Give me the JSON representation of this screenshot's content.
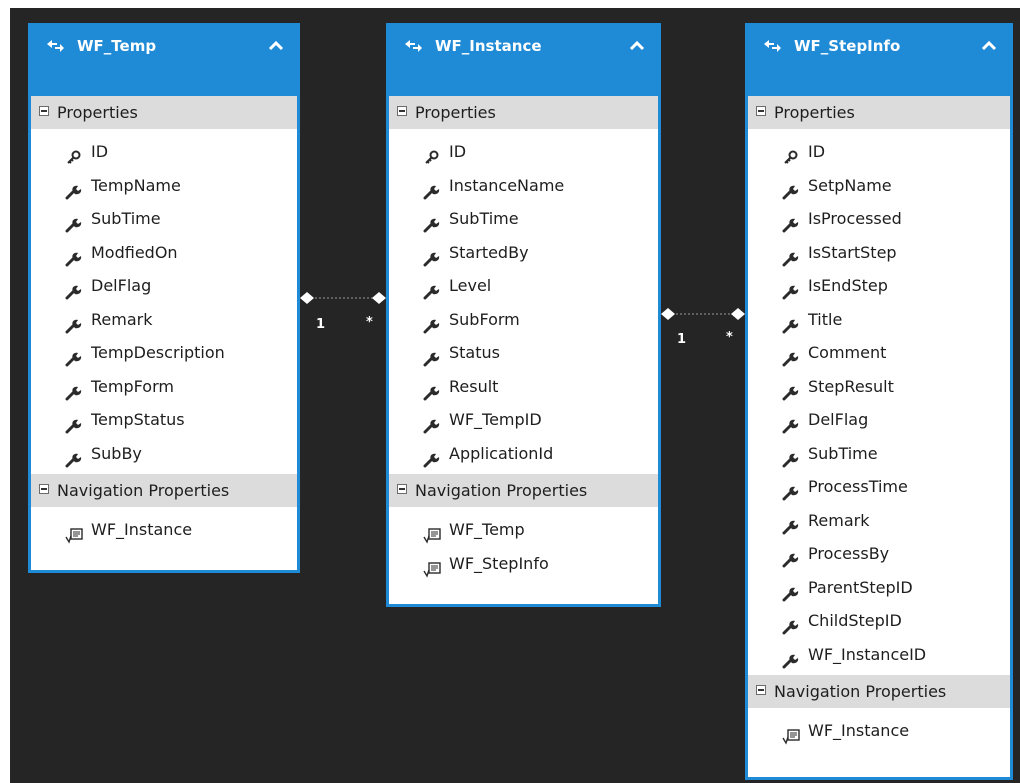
{
  "entities": {
    "temp": {
      "title": "WF_Temp",
      "properties_label": "Properties",
      "navigation_label": "Navigation Properties",
      "properties": [
        {
          "label": "ID",
          "icon": "key-icon"
        },
        {
          "label": "TempName",
          "icon": "wrench-icon"
        },
        {
          "label": "SubTime",
          "icon": "wrench-icon"
        },
        {
          "label": "ModfiedOn",
          "icon": "wrench-icon"
        },
        {
          "label": "DelFlag",
          "icon": "wrench-icon"
        },
        {
          "label": "Remark",
          "icon": "wrench-icon"
        },
        {
          "label": "TempDescription",
          "icon": "wrench-icon"
        },
        {
          "label": "TempForm",
          "icon": "wrench-icon"
        },
        {
          "label": "TempStatus",
          "icon": "wrench-icon"
        },
        {
          "label": "SubBy",
          "icon": "wrench-icon"
        }
      ],
      "navigation": [
        {
          "label": "WF_Instance",
          "icon": "navigation-icon"
        }
      ]
    },
    "instance": {
      "title": "WF_Instance",
      "properties_label": "Properties",
      "navigation_label": "Navigation Properties",
      "properties": [
        {
          "label": "ID",
          "icon": "key-icon"
        },
        {
          "label": "InstanceName",
          "icon": "wrench-icon"
        },
        {
          "label": "SubTime",
          "icon": "wrench-icon"
        },
        {
          "label": "StartedBy",
          "icon": "wrench-icon"
        },
        {
          "label": "Level",
          "icon": "wrench-icon"
        },
        {
          "label": "SubForm",
          "icon": "wrench-icon"
        },
        {
          "label": "Status",
          "icon": "wrench-icon"
        },
        {
          "label": "Result",
          "icon": "wrench-icon"
        },
        {
          "label": "WF_TempID",
          "icon": "wrench-icon"
        },
        {
          "label": "ApplicationId",
          "icon": "wrench-icon"
        }
      ],
      "navigation": [
        {
          "label": "WF_Temp",
          "icon": "navigation-icon"
        },
        {
          "label": "WF_StepInfo",
          "icon": "navigation-icon"
        }
      ]
    },
    "stepinfo": {
      "title": "WF_StepInfo",
      "properties_label": "Properties",
      "navigation_label": "Navigation Properties",
      "properties": [
        {
          "label": "ID",
          "icon": "key-icon"
        },
        {
          "label": "SetpName",
          "icon": "wrench-icon"
        },
        {
          "label": "IsProcessed",
          "icon": "wrench-icon"
        },
        {
          "label": "IsStartStep",
          "icon": "wrench-icon"
        },
        {
          "label": "IsEndStep",
          "icon": "wrench-icon"
        },
        {
          "label": "Title",
          "icon": "wrench-icon"
        },
        {
          "label": "Comment",
          "icon": "wrench-icon"
        },
        {
          "label": "StepResult",
          "icon": "wrench-icon"
        },
        {
          "label": "DelFlag",
          "icon": "wrench-icon"
        },
        {
          "label": "SubTime",
          "icon": "wrench-icon"
        },
        {
          "label": "ProcessTime",
          "icon": "wrench-icon"
        },
        {
          "label": "Remark",
          "icon": "wrench-icon"
        },
        {
          "label": "ProcessBy",
          "icon": "wrench-icon"
        },
        {
          "label": "ParentStepID",
          "icon": "wrench-icon"
        },
        {
          "label": "ChildStepID",
          "icon": "wrench-icon"
        },
        {
          "label": "WF_InstanceID",
          "icon": "wrench-icon"
        }
      ],
      "navigation": [
        {
          "label": "WF_Instance",
          "icon": "navigation-icon"
        }
      ]
    }
  },
  "associations": [
    {
      "from": "WF_Temp",
      "to": "WF_Instance",
      "from_multiplicity": "1",
      "to_multiplicity": "*"
    },
    {
      "from": "WF_Instance",
      "to": "WF_StepInfo",
      "from_multiplicity": "1",
      "to_multiplicity": "*"
    }
  ],
  "colors": {
    "canvas": "#252526",
    "header": "#1f8ad6",
    "section": "#dcdcdc",
    "connector": "#9a9a9a"
  }
}
